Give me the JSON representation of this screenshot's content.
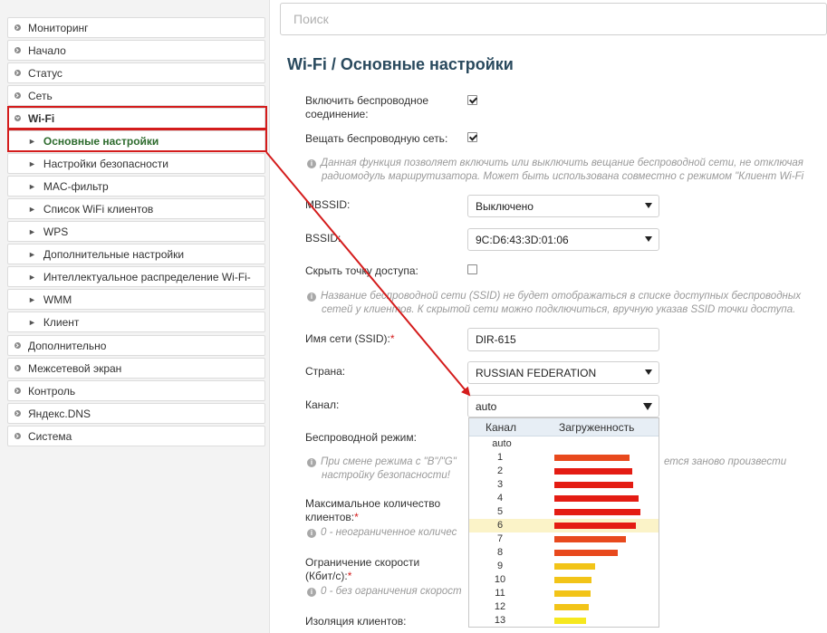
{
  "search": {
    "placeholder": "Поиск"
  },
  "page": {
    "title": "Wi-Fi /  Основные настройки"
  },
  "sidebar": {
    "items": [
      {
        "label": "Мониторинг"
      },
      {
        "label": "Начало"
      },
      {
        "label": "Статус"
      },
      {
        "label": "Сеть"
      },
      {
        "label": "Wi-Fi"
      }
    ],
    "subitems": [
      {
        "label": "Основные настройки"
      },
      {
        "label": "Настройки безопасности"
      },
      {
        "label": "MAC-фильтр"
      },
      {
        "label": "Список WiFi клиентов"
      },
      {
        "label": "WPS"
      },
      {
        "label": "Дополнительные настройки"
      },
      {
        "label": "Интеллектуальное распределение Wi-Fi-"
      },
      {
        "label": "WMM"
      },
      {
        "label": "Клиент"
      }
    ],
    "bottom_items": [
      {
        "label": "Дополнительно"
      },
      {
        "label": "Межсетевой экран"
      },
      {
        "label": "Контроль"
      },
      {
        "label": "Яндекс.DNS"
      },
      {
        "label": "Система"
      }
    ]
  },
  "form": {
    "enable_wireless": {
      "label_line1": "Включить беспроводное",
      "label_line2": "соединение:",
      "checked": true
    },
    "broadcast": {
      "label": "Вещать беспроводную сеть:",
      "checked": true
    },
    "broadcast_hint": {
      "line1": "Данная функция позволяет включить или выключить вещание беспроводной сети, не отключая",
      "line2": "радиомодуль маршрутизатора. Может быть использована совместно с режимом \"Клиент Wi-Fi"
    },
    "mbssid": {
      "label": "MBSSID:",
      "value": "Выключено"
    },
    "bssid": {
      "label": "BSSID:",
      "value": "9C:D6:43:3D:01:06"
    },
    "hide_ap": {
      "label": "Скрыть точку доступа:",
      "checked": false
    },
    "hide_hint": {
      "line1": "Название беспроводной сети (SSID) не будет отображаться в списке доступных беспроводных",
      "line2": "сетей у клиентов. К скрытой сети можно подключиться, вручную указав SSID точки доступа."
    },
    "ssid": {
      "label": "Имя сети (SSID):",
      "req": "*",
      "value": "DIR-615"
    },
    "country": {
      "label": "Страна:",
      "value": "RUSSIAN FEDERATION"
    },
    "channel": {
      "label": "Канал:",
      "value": "auto"
    },
    "wireless_mode": {
      "label": "Беспроводной режим:"
    },
    "mode_hint": {
      "line1": "При смене режима с \"B\"/\"G\"",
      "line1_tail": "ется заново произвести",
      "line2": "настройку безопасности!"
    },
    "max_clients": {
      "label_line1": "Максимальное количество",
      "label_line2": "клиентов:",
      "req": "*"
    },
    "max_hint": {
      "text": "0 - неограниченное количес"
    },
    "speed_limit": {
      "label_line1": "Ограничение скорости",
      "label_line2": "(Кбит/с):",
      "req": "*"
    },
    "speed_hint": {
      "text": "0 - без ограничения скорост"
    },
    "isolation": {
      "label": "Изоляция клиентов:"
    }
  },
  "channel_dropdown": {
    "col_channel": "Канал",
    "col_load": "Загруженность",
    "auto_label": "auto",
    "highlighted": "6",
    "rows": [
      {
        "ch": "1",
        "load": 0.72,
        "color": "#e8491d"
      },
      {
        "ch": "2",
        "load": 0.75,
        "color": "#e41c13"
      },
      {
        "ch": "3",
        "load": 0.76,
        "color": "#e41c13"
      },
      {
        "ch": "4",
        "load": 0.81,
        "color": "#e41c13"
      },
      {
        "ch": "5",
        "load": 0.83,
        "color": "#e41c13"
      },
      {
        "ch": "6",
        "load": 0.78,
        "color": "#e41c13"
      },
      {
        "ch": "7",
        "load": 0.69,
        "color": "#e8491d"
      },
      {
        "ch": "8",
        "load": 0.61,
        "color": "#e8491d"
      },
      {
        "ch": "9",
        "load": 0.39,
        "color": "#f2c418"
      },
      {
        "ch": "10",
        "load": 0.36,
        "color": "#f2c418"
      },
      {
        "ch": "11",
        "load": 0.35,
        "color": "#f2c418"
      },
      {
        "ch": "12",
        "load": 0.33,
        "color": "#f2c418"
      },
      {
        "ch": "13",
        "load": 0.3,
        "color": "#f6e81f"
      }
    ]
  },
  "colors": {
    "title": "#2a4a5e",
    "active_menu": "#2d6b2d",
    "annotation_red": "#d41c1c",
    "dropdown_header": "#e7eef5"
  }
}
